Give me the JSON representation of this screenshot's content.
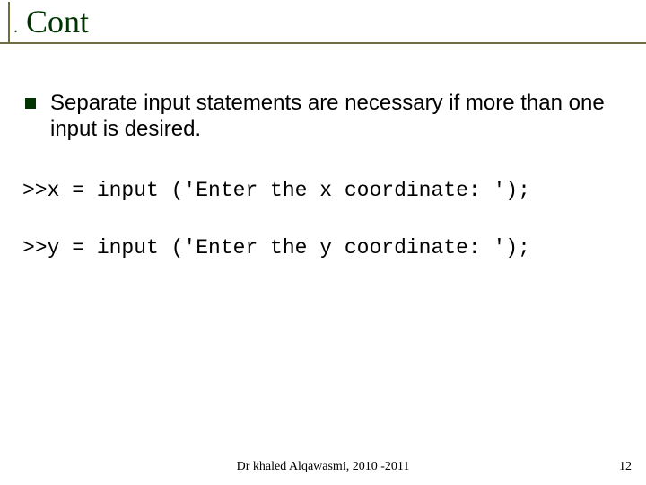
{
  "title": {
    "dot": ".",
    "text": " Cont"
  },
  "bullet": "Separate input statements are necessary if more than one input is desired.",
  "code1": ">>x = input ('Enter the x coordinate: ');",
  "code2": ">>y = input ('Enter the y coordinate: ');",
  "footer": {
    "center": "Dr khaled Alqawasmi, 2010 -2011",
    "page": "12"
  }
}
